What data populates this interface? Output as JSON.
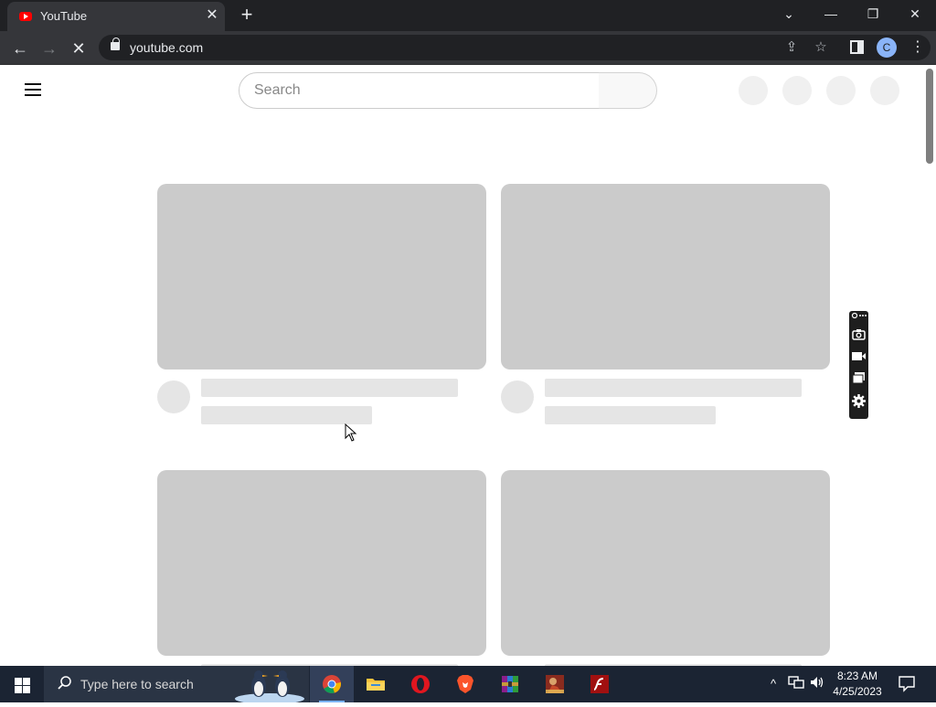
{
  "browser": {
    "tab_title": "YouTube",
    "tab_close_glyph": "✕",
    "new_tab_glyph": "+",
    "url": "youtube.com",
    "profile_initial": "C",
    "window_controls": {
      "tabs_menu": "⌄",
      "minimize": "—",
      "restore": "❐",
      "close": "✕"
    },
    "nav": {
      "back": "←",
      "forward": "→",
      "reload_stop": "✕"
    },
    "omnibox_icons": {
      "share": "⇪",
      "bookmark": "☆"
    },
    "menu_glyph": "⋮"
  },
  "youtube": {
    "search": {
      "placeholder": "Search"
    },
    "loading": true
  },
  "extension_toolbar": {
    "icons": [
      "link-icon",
      "camera-icon",
      "video-icon",
      "windows-icon",
      "settings-icon"
    ]
  },
  "taskbar": {
    "search_placeholder": "Type here to search",
    "clock": {
      "time": "8:23 AM",
      "date": "4/25/2023"
    },
    "apps": [
      "chrome",
      "file-explorer",
      "opera",
      "brave",
      "winrar",
      "game",
      "flash"
    ],
    "tray": {
      "chevron": "^",
      "network": "🖧",
      "volume": "🔊"
    }
  },
  "colors": {
    "chrome_dark": "#202124",
    "chrome_toolbar": "#35363a",
    "skeleton_thumb": "#cbcbcb",
    "skeleton_text": "#e5e5e5",
    "taskbar": "#1b2433"
  }
}
